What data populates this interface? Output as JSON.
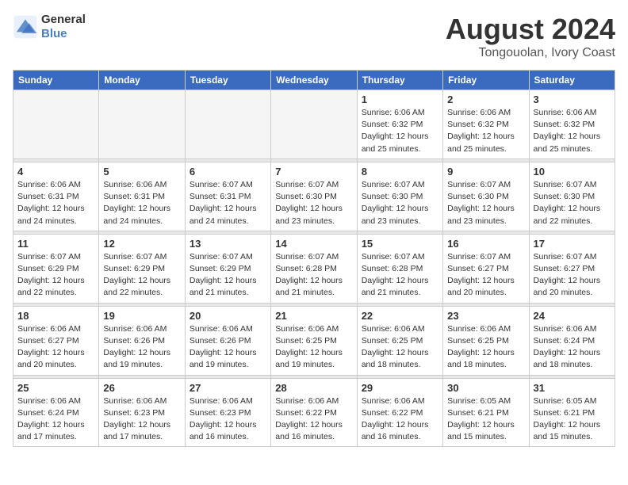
{
  "header": {
    "logo_general": "General",
    "logo_blue": "Blue",
    "month_year": "August 2024",
    "location": "Tongouolan, Ivory Coast"
  },
  "weekdays": [
    "Sunday",
    "Monday",
    "Tuesday",
    "Wednesday",
    "Thursday",
    "Friday",
    "Saturday"
  ],
  "weeks": [
    [
      {
        "day": "",
        "info": ""
      },
      {
        "day": "",
        "info": ""
      },
      {
        "day": "",
        "info": ""
      },
      {
        "day": "",
        "info": ""
      },
      {
        "day": "1",
        "info": "Sunrise: 6:06 AM\nSunset: 6:32 PM\nDaylight: 12 hours\nand 25 minutes."
      },
      {
        "day": "2",
        "info": "Sunrise: 6:06 AM\nSunset: 6:32 PM\nDaylight: 12 hours\nand 25 minutes."
      },
      {
        "day": "3",
        "info": "Sunrise: 6:06 AM\nSunset: 6:32 PM\nDaylight: 12 hours\nand 25 minutes."
      }
    ],
    [
      {
        "day": "4",
        "info": "Sunrise: 6:06 AM\nSunset: 6:31 PM\nDaylight: 12 hours\nand 24 minutes."
      },
      {
        "day": "5",
        "info": "Sunrise: 6:06 AM\nSunset: 6:31 PM\nDaylight: 12 hours\nand 24 minutes."
      },
      {
        "day": "6",
        "info": "Sunrise: 6:07 AM\nSunset: 6:31 PM\nDaylight: 12 hours\nand 24 minutes."
      },
      {
        "day": "7",
        "info": "Sunrise: 6:07 AM\nSunset: 6:30 PM\nDaylight: 12 hours\nand 23 minutes."
      },
      {
        "day": "8",
        "info": "Sunrise: 6:07 AM\nSunset: 6:30 PM\nDaylight: 12 hours\nand 23 minutes."
      },
      {
        "day": "9",
        "info": "Sunrise: 6:07 AM\nSunset: 6:30 PM\nDaylight: 12 hours\nand 23 minutes."
      },
      {
        "day": "10",
        "info": "Sunrise: 6:07 AM\nSunset: 6:30 PM\nDaylight: 12 hours\nand 22 minutes."
      }
    ],
    [
      {
        "day": "11",
        "info": "Sunrise: 6:07 AM\nSunset: 6:29 PM\nDaylight: 12 hours\nand 22 minutes."
      },
      {
        "day": "12",
        "info": "Sunrise: 6:07 AM\nSunset: 6:29 PM\nDaylight: 12 hours\nand 22 minutes."
      },
      {
        "day": "13",
        "info": "Sunrise: 6:07 AM\nSunset: 6:29 PM\nDaylight: 12 hours\nand 21 minutes."
      },
      {
        "day": "14",
        "info": "Sunrise: 6:07 AM\nSunset: 6:28 PM\nDaylight: 12 hours\nand 21 minutes."
      },
      {
        "day": "15",
        "info": "Sunrise: 6:07 AM\nSunset: 6:28 PM\nDaylight: 12 hours\nand 21 minutes."
      },
      {
        "day": "16",
        "info": "Sunrise: 6:07 AM\nSunset: 6:27 PM\nDaylight: 12 hours\nand 20 minutes."
      },
      {
        "day": "17",
        "info": "Sunrise: 6:07 AM\nSunset: 6:27 PM\nDaylight: 12 hours\nand 20 minutes."
      }
    ],
    [
      {
        "day": "18",
        "info": "Sunrise: 6:06 AM\nSunset: 6:27 PM\nDaylight: 12 hours\nand 20 minutes."
      },
      {
        "day": "19",
        "info": "Sunrise: 6:06 AM\nSunset: 6:26 PM\nDaylight: 12 hours\nand 19 minutes."
      },
      {
        "day": "20",
        "info": "Sunrise: 6:06 AM\nSunset: 6:26 PM\nDaylight: 12 hours\nand 19 minutes."
      },
      {
        "day": "21",
        "info": "Sunrise: 6:06 AM\nSunset: 6:25 PM\nDaylight: 12 hours\nand 19 minutes."
      },
      {
        "day": "22",
        "info": "Sunrise: 6:06 AM\nSunset: 6:25 PM\nDaylight: 12 hours\nand 18 minutes."
      },
      {
        "day": "23",
        "info": "Sunrise: 6:06 AM\nSunset: 6:25 PM\nDaylight: 12 hours\nand 18 minutes."
      },
      {
        "day": "24",
        "info": "Sunrise: 6:06 AM\nSunset: 6:24 PM\nDaylight: 12 hours\nand 18 minutes."
      }
    ],
    [
      {
        "day": "25",
        "info": "Sunrise: 6:06 AM\nSunset: 6:24 PM\nDaylight: 12 hours\nand 17 minutes."
      },
      {
        "day": "26",
        "info": "Sunrise: 6:06 AM\nSunset: 6:23 PM\nDaylight: 12 hours\nand 17 minutes."
      },
      {
        "day": "27",
        "info": "Sunrise: 6:06 AM\nSunset: 6:23 PM\nDaylight: 12 hours\nand 16 minutes."
      },
      {
        "day": "28",
        "info": "Sunrise: 6:06 AM\nSunset: 6:22 PM\nDaylight: 12 hours\nand 16 minutes."
      },
      {
        "day": "29",
        "info": "Sunrise: 6:06 AM\nSunset: 6:22 PM\nDaylight: 12 hours\nand 16 minutes."
      },
      {
        "day": "30",
        "info": "Sunrise: 6:05 AM\nSunset: 6:21 PM\nDaylight: 12 hours\nand 15 minutes."
      },
      {
        "day": "31",
        "info": "Sunrise: 6:05 AM\nSunset: 6:21 PM\nDaylight: 12 hours\nand 15 minutes."
      }
    ]
  ]
}
